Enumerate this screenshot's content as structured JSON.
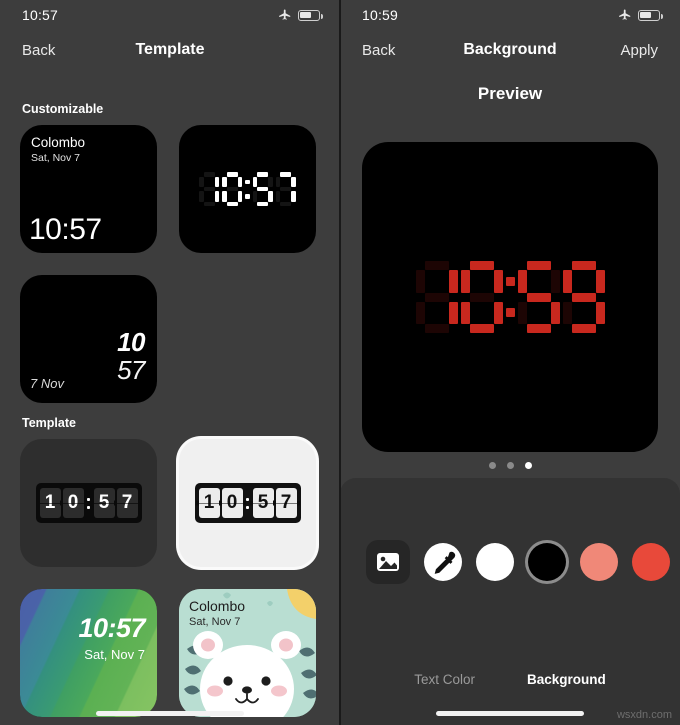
{
  "left": {
    "status": {
      "time": "10:57",
      "airplane_icon": "airplane-icon",
      "battery_icon": "battery-icon",
      "battery_level": 60
    },
    "nav": {
      "back": "Back",
      "title": "Template"
    },
    "sections": [
      {
        "label": "Customizable"
      },
      {
        "label": "Template"
      }
    ],
    "cards": {
      "colombo_minimal": {
        "city": "Colombo",
        "date": "Sat, Nov 7",
        "time": "10:57"
      },
      "seven_segment": {
        "time": "10:57"
      },
      "slanted": {
        "hour": "10",
        "minute": "57",
        "date": "7 Nov"
      },
      "flip_dark": {
        "time": "10:57",
        "digits": [
          "1",
          "0",
          "5",
          "7"
        ]
      },
      "flip_light": {
        "time": "10:57",
        "digits": [
          "1",
          "0",
          "5",
          "7"
        ],
        "selected": true
      },
      "gradient": {
        "time": "10:57",
        "date": "Sat, Nov 7"
      },
      "bear": {
        "city": "Colombo",
        "date": "Sat, Nov 7"
      }
    }
  },
  "right": {
    "status": {
      "time": "10:59",
      "airplane_icon": "airplane-icon",
      "battery_icon": "battery-icon",
      "battery_level": 60
    },
    "nav": {
      "back": "Back",
      "title": "Background",
      "apply": "Apply"
    },
    "preview": {
      "heading": "Preview",
      "time": "10:59",
      "led_color": "#c8281e"
    },
    "pager": {
      "count": 3,
      "active_index": 2
    },
    "swatches": [
      {
        "name": "image-picker",
        "icon": "image-icon",
        "type": "button"
      },
      {
        "name": "eyedropper",
        "icon": "eyedropper-icon",
        "color": "#ffffff",
        "type": "tool"
      },
      {
        "name": "white",
        "color": "#ffffff",
        "selected": false
      },
      {
        "name": "black",
        "color": "#000000",
        "selected": true
      },
      {
        "name": "salmon",
        "color": "#f08878",
        "selected": false
      },
      {
        "name": "red",
        "color": "#e8493a",
        "selected": false
      }
    ],
    "tabs": [
      {
        "label": "Text Color",
        "active": false
      },
      {
        "label": "Background",
        "active": true
      }
    ]
  },
  "watermark": "wsxdn.com"
}
